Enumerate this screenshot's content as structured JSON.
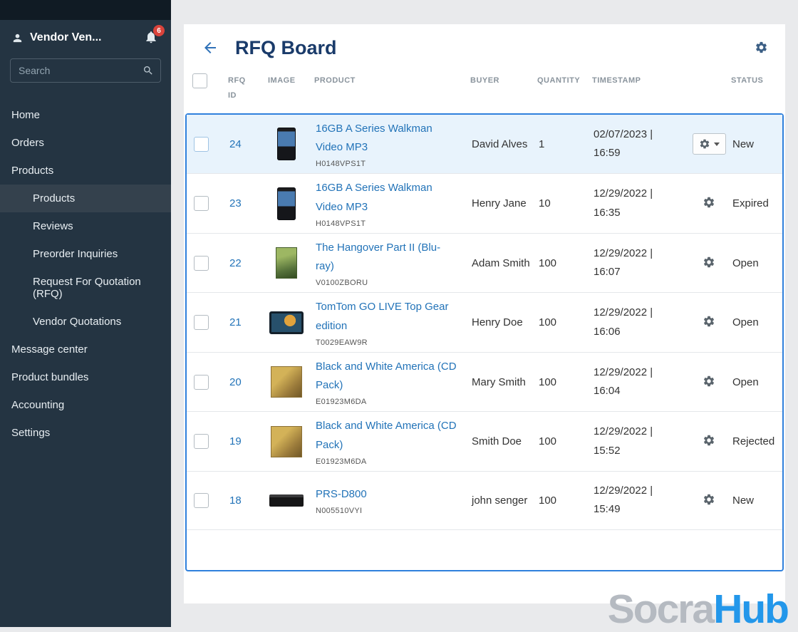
{
  "sidebar": {
    "vendor_name": "Vendor Ven...",
    "notification_count": "6",
    "search_placeholder": "Search",
    "nav_top": [
      {
        "label": "Home"
      },
      {
        "label": "Orders"
      },
      {
        "label": "Products"
      }
    ],
    "products_subnav": [
      {
        "label": "Products",
        "active": true
      },
      {
        "label": "Reviews"
      },
      {
        "label": "Preorder Inquiries"
      },
      {
        "label": "Request For Quotation (RFQ)"
      },
      {
        "label": "Vendor Quotations"
      }
    ],
    "nav_bottom": [
      {
        "label": "Message center"
      },
      {
        "label": "Product bundles"
      },
      {
        "label": "Accounting"
      },
      {
        "label": "Settings"
      }
    ]
  },
  "header": {
    "title": "RFQ Board"
  },
  "table": {
    "headers": {
      "rfq_id": "RFQ ID",
      "image": "IMAGE",
      "product": "PRODUCT",
      "buyer": "BUYER",
      "quantity": "QUANTITY",
      "timestamp": "TIMESTAMP",
      "status": "STATUS"
    },
    "rows": [
      {
        "id": "24",
        "product": "16GB A Series Walkman Video MP3",
        "code": "H0148VPS1T",
        "buyer": "David Alves",
        "quantity": "1",
        "timestamp": "02/07/2023 | 16:59",
        "status": "New"
      },
      {
        "id": "23",
        "product": "16GB A Series Walkman Video MP3",
        "code": "H0148VPS1T",
        "buyer": "Henry Jane",
        "quantity": "10",
        "timestamp": "12/29/2022 | 16:35",
        "status": "Expired"
      },
      {
        "id": "22",
        "product": "The Hangover Part II (Blu-ray)",
        "code": "V0100ZBORU",
        "buyer": "Adam Smith",
        "quantity": "100",
        "timestamp": "12/29/2022 | 16:07",
        "status": "Open"
      },
      {
        "id": "21",
        "product": "TomTom GO LIVE Top Gear edition",
        "code": "T0029EAW9R",
        "buyer": "Henry Doe",
        "quantity": "100",
        "timestamp": "12/29/2022 | 16:06",
        "status": "Open"
      },
      {
        "id": "20",
        "product": "Black and White America (CD Pack)",
        "code": "E01923M6DA",
        "buyer": "Mary Smith",
        "quantity": "100",
        "timestamp": "12/29/2022 | 16:04",
        "status": "Open"
      },
      {
        "id": "19",
        "product": "Black and White America (CD Pack)",
        "code": "E01923M6DA",
        "buyer": "Smith Doe",
        "quantity": "100",
        "timestamp": "12/29/2022 | 15:52",
        "status": "Rejected"
      },
      {
        "id": "18",
        "product": "PRS-D800",
        "code": "N005510VYI",
        "buyer": "john senger",
        "quantity": "100",
        "timestamp": "12/29/2022 | 15:49",
        "status": "New"
      }
    ]
  },
  "watermark": {
    "gray": "Socra",
    "blue": "Hub"
  },
  "colors": {
    "accent_border": "#2f80dc",
    "link": "#2273b8",
    "sidebar_bg": "#243442",
    "badge": "#d9433b",
    "selected_row": "#e8f3fc",
    "title": "#1a3b6a"
  }
}
